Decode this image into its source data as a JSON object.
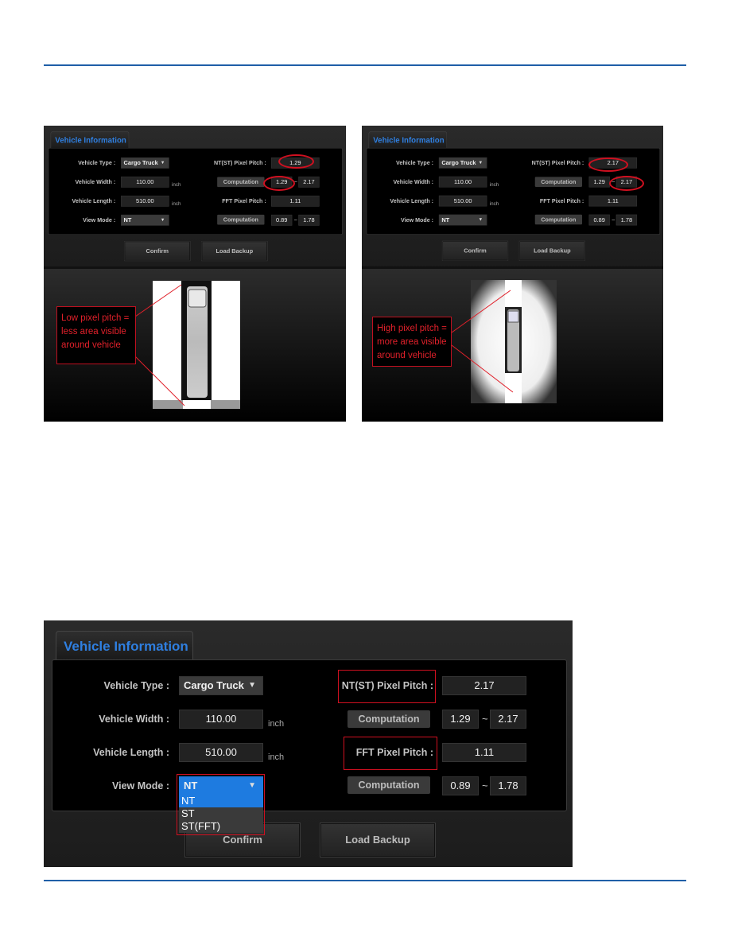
{
  "formA": {
    "tab": "Vehicle Information",
    "vehicle_type_label": "Vehicle Type :",
    "vehicle_type": "Cargo Truck",
    "vehicle_width_label": "Vehicle Width :",
    "vehicle_width": "110.00",
    "width_unit": "inch",
    "vehicle_length_label": "Vehicle Length :",
    "vehicle_length": "510.00",
    "length_unit": "inch",
    "view_mode_label": "View Mode :",
    "view_mode": "NT",
    "ntst_label": "NT(ST) Pixel Pitch :",
    "ntst_value": "1.29",
    "computation": "Computation",
    "ntst_min": "1.29",
    "ntst_max": "2.17",
    "fft_label": "FFT Pixel Pitch :",
    "fft_value": "1.11",
    "fft_min": "0.89",
    "fft_max": "1.78",
    "tilde": "~",
    "confirm": "Confirm",
    "load_backup": "Load Backup",
    "note": "Low pixel pitch = less area visible around vehicle"
  },
  "formB": {
    "tab": "Vehicle Information",
    "vehicle_type_label": "Vehicle Type :",
    "vehicle_type": "Cargo Truck",
    "vehicle_width_label": "Vehicle Width :",
    "vehicle_width": "110.00",
    "width_unit": "inch",
    "vehicle_length_label": "Vehicle Length :",
    "vehicle_length": "510.00",
    "length_unit": "inch",
    "view_mode_label": "View Mode :",
    "view_mode": "NT",
    "ntst_label": "NT(ST) Pixel Pitch :",
    "ntst_value": "2.17",
    "computation": "Computation",
    "ntst_min": "1.29",
    "ntst_max": "2.17",
    "fft_label": "FFT Pixel Pitch :",
    "fft_value": "1.11",
    "fft_min": "0.89",
    "fft_max": "1.78",
    "tilde": "~",
    "confirm": "Confirm",
    "load_backup": "Load Backup",
    "note": "High pixel pitch = more area visible around vehicle"
  },
  "formC": {
    "tab": "Vehicle Information",
    "vehicle_type_label": "Vehicle Type :",
    "vehicle_type": "Cargo Truck",
    "vehicle_width_label": "Vehicle Width :",
    "vehicle_width": "110.00",
    "width_unit": "inch",
    "vehicle_length_label": "Vehicle Length :",
    "vehicle_length": "510.00",
    "length_unit": "inch",
    "view_mode_label": "View Mode :",
    "view_mode": "NT",
    "view_mode_options": [
      "NT",
      "ST",
      "ST(FFT)"
    ],
    "ntst_label": "NT(ST) Pixel Pitch :",
    "ntst_value": "2.17",
    "computation": "Computation",
    "ntst_min": "1.29",
    "ntst_max": "2.17",
    "fft_label": "FFT Pixel Pitch :",
    "fft_value": "1.11",
    "fft_min": "0.89",
    "fft_max": "1.78",
    "tilde": "~",
    "confirm": "Confirm",
    "load_backup": "Load Backup"
  },
  "colors": {
    "rule": "#1f5fa8",
    "annotation": "#d01020",
    "tab_text": "#2f7fe0",
    "selection": "#1e7be0"
  }
}
